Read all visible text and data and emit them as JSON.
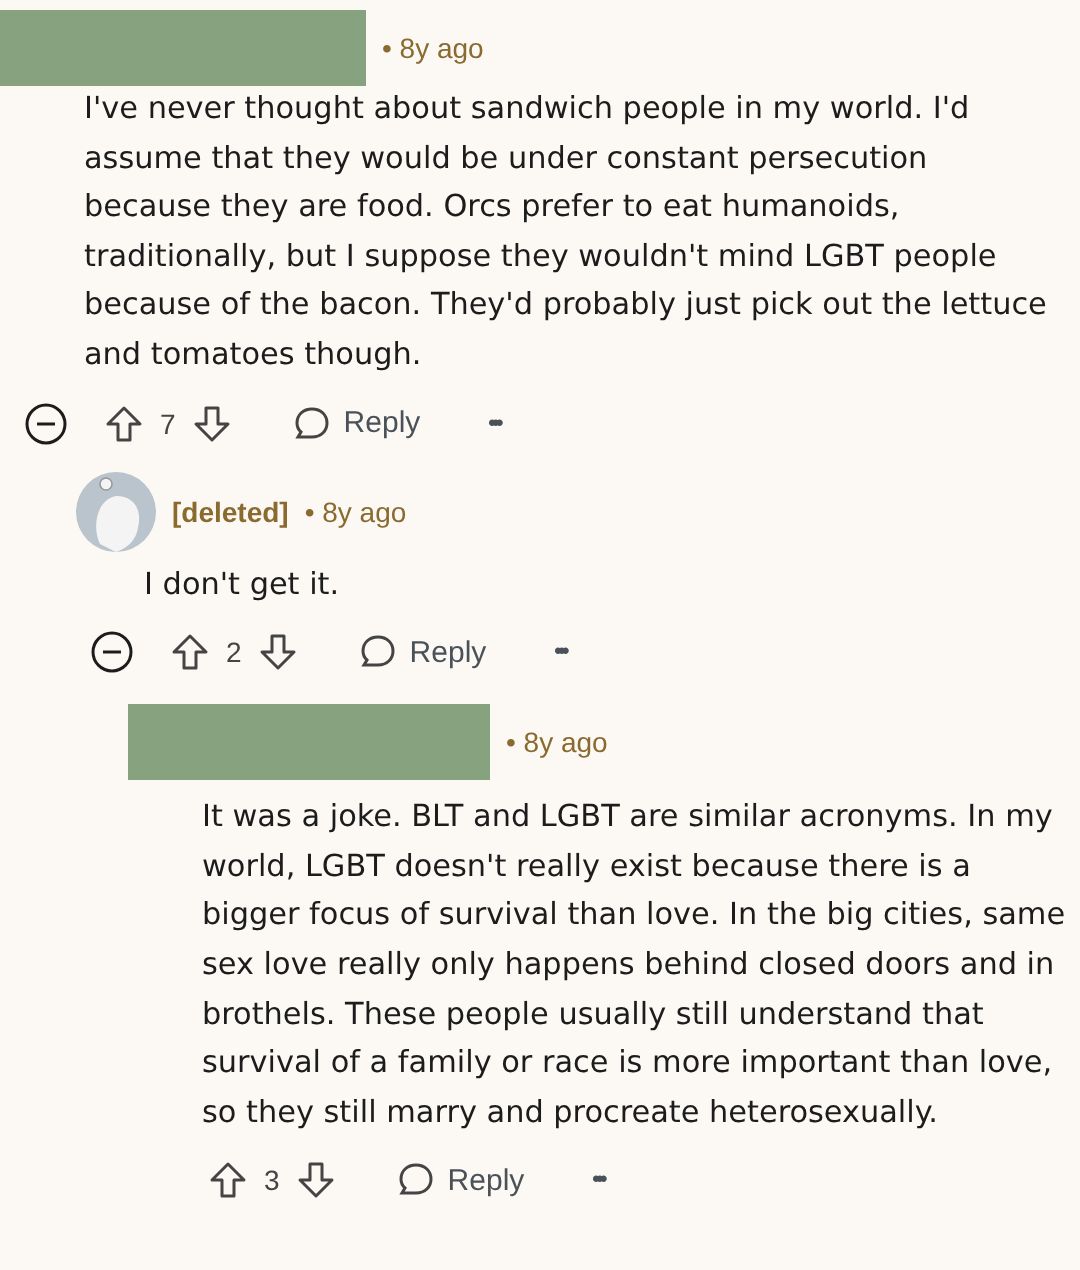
{
  "comments": [
    {
      "author": {
        "kind": "redacted"
      },
      "time": "• 8y ago",
      "body": "I've never thought about sandwich people in my world. I'd assume that they would be under constant persecution because they are food. Orcs prefer to eat humanoids, traditionally, but I suppose they wouldn't mind LGBT people because of the bacon. They'd probably just pick out the lettuce and tomatoes though.",
      "votes": "7",
      "reply": "Reply",
      "more": "•••",
      "expanded": true,
      "children": [
        {
          "author": {
            "kind": "deleted",
            "name": "[deleted]"
          },
          "time": "• 8y ago",
          "body": "I don't get it.",
          "votes": "2",
          "reply": "Reply",
          "more": "•••",
          "expanded": true,
          "children": [
            {
              "author": {
                "kind": "redacted"
              },
              "time": "• 8y ago",
              "body": "It was a joke. BLT and LGBT are similar acronyms. In my world, LGBT doesn't really exist because there is a bigger focus of survival than love. In the big cities, same sex love really only happens behind closed doors and in brothels. These people usually still understand that survival of a family or race is more important than love, so they still marry and procreate heterosexually.",
              "votes": "3",
              "reply": "Reply",
              "more": "•••"
            }
          ]
        }
      ]
    }
  ]
}
